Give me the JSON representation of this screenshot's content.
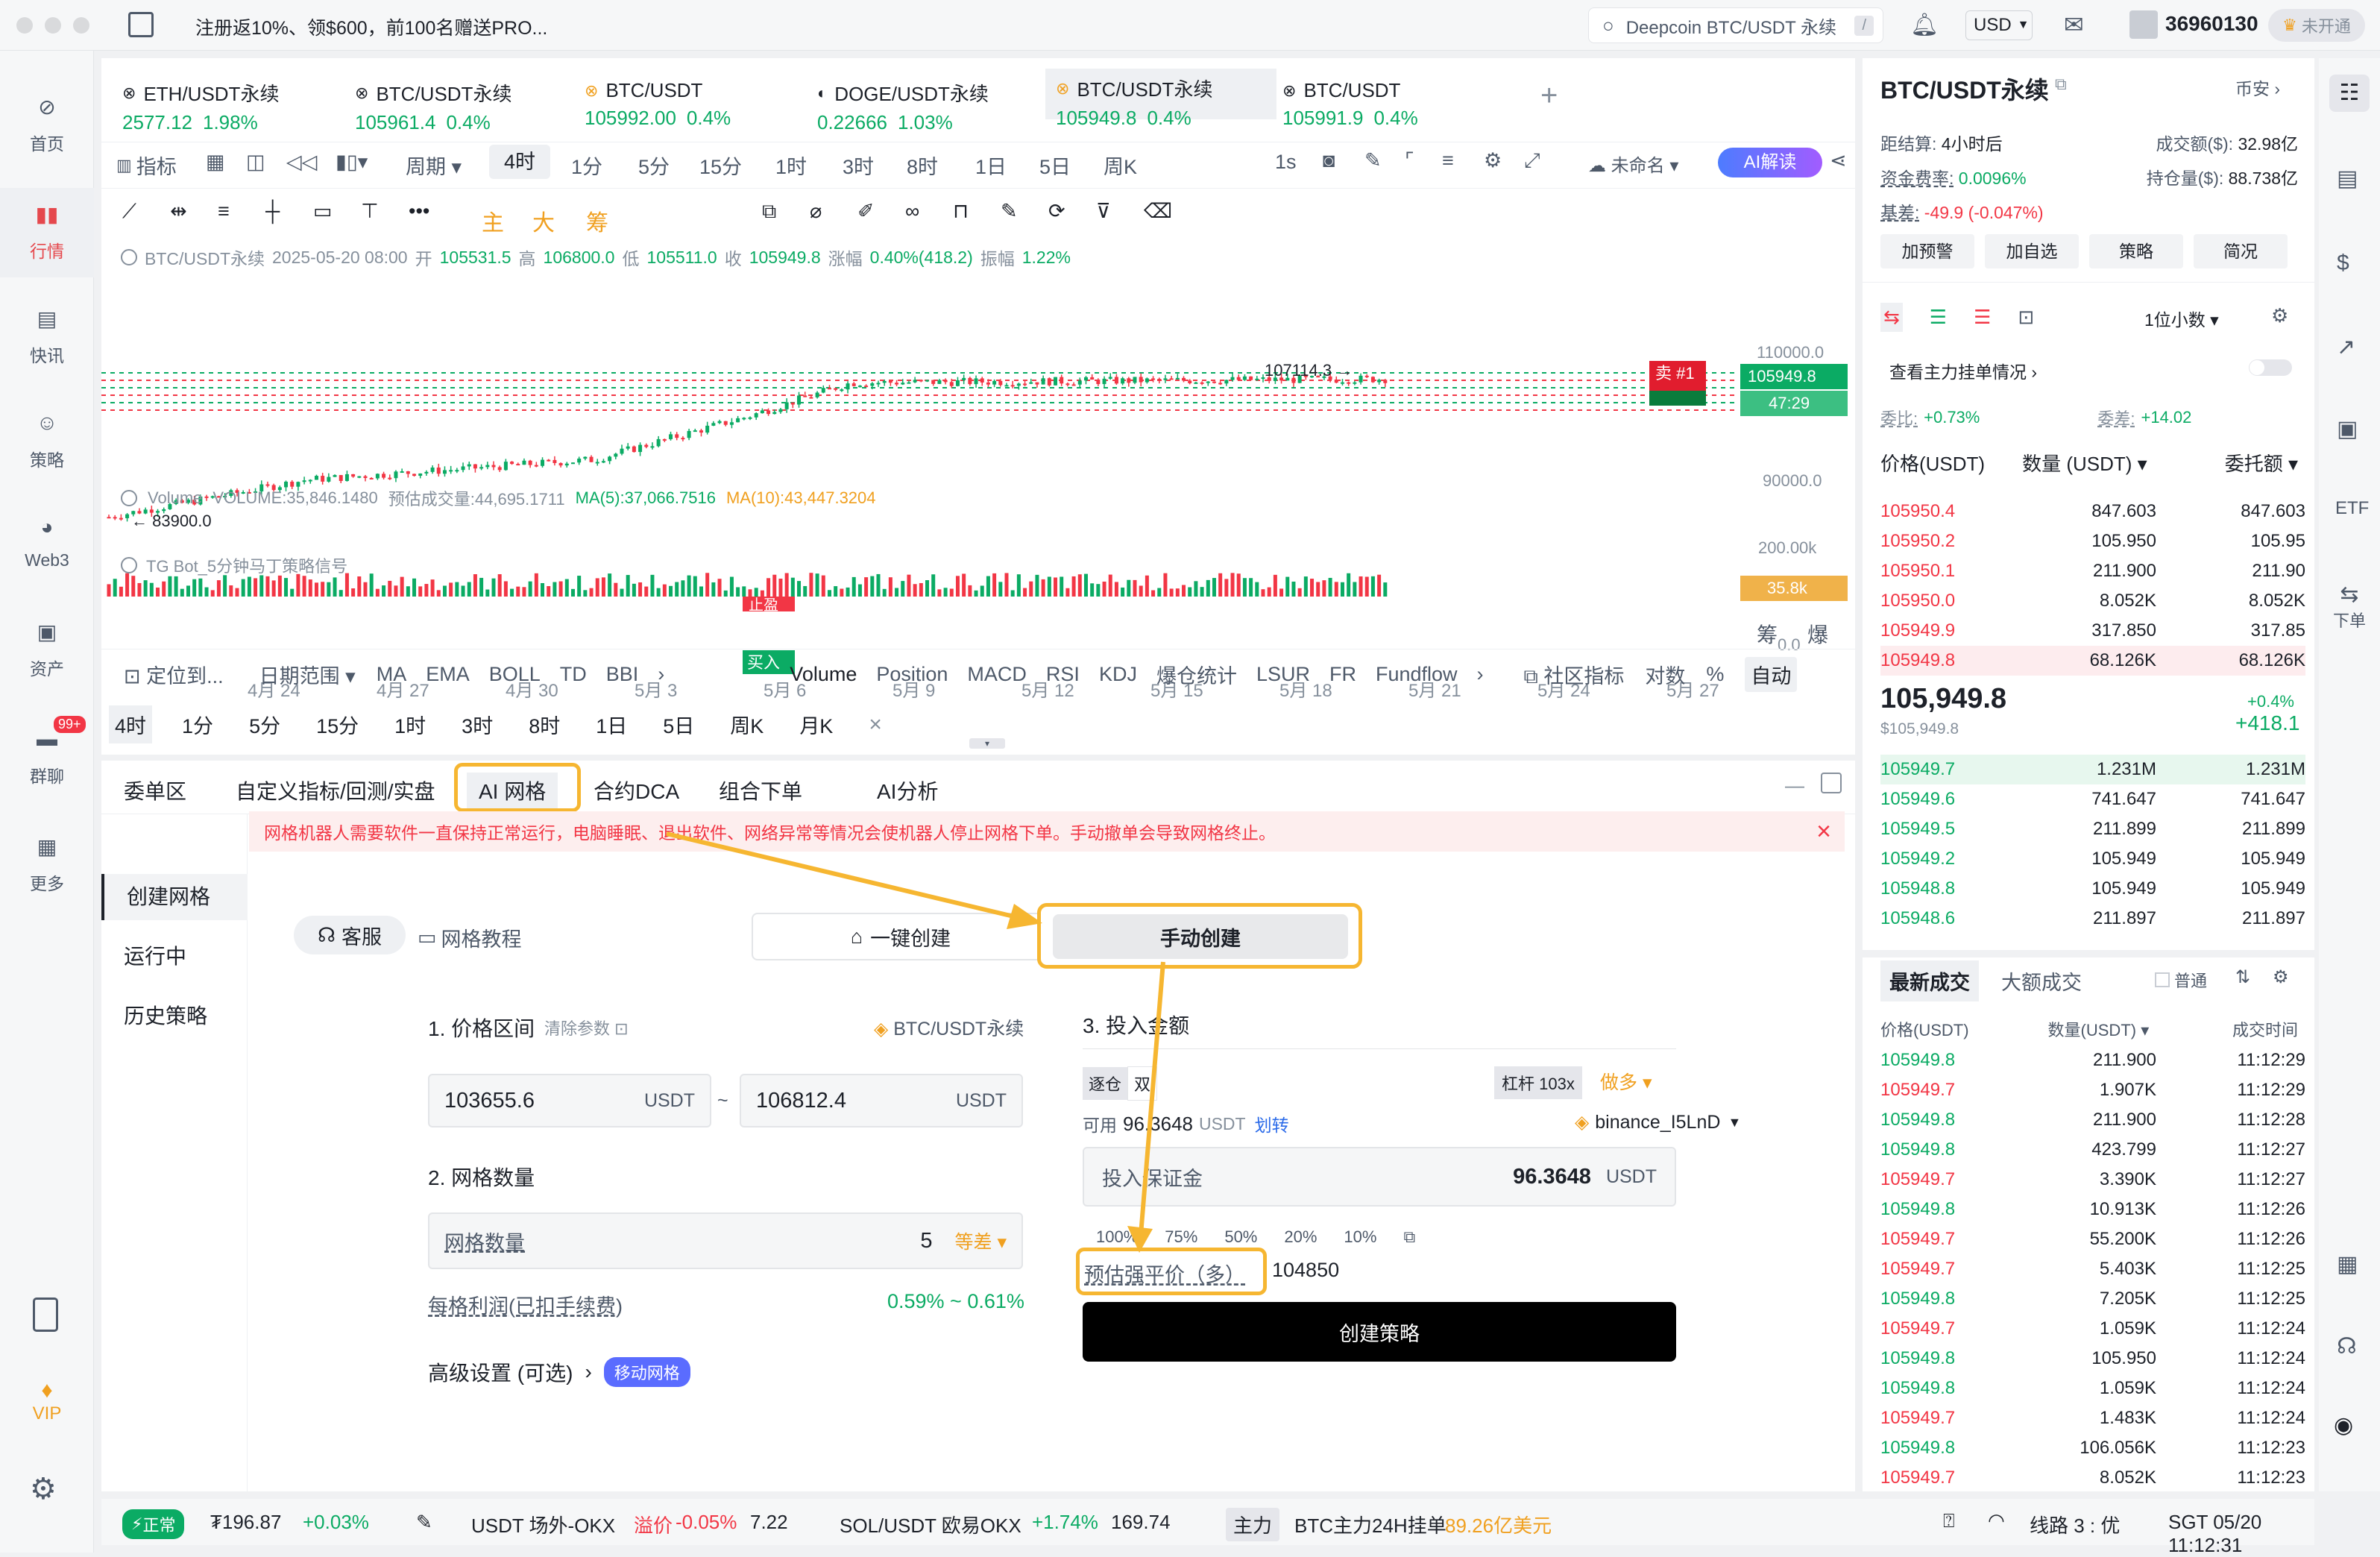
{
  "topbar": {
    "promo": "注册返10%、领$600，前100名赠送PRO...",
    "search": "Deepcoin BTC/USDT 永续",
    "search_shortcut": "/",
    "currency": "USD",
    "user_id": "36960130",
    "status": "未开通"
  },
  "leftnav": [
    {
      "label": "首页",
      "icon": "home-icon"
    },
    {
      "label": "行情",
      "icon": "chart-icon"
    },
    {
      "label": "快讯",
      "icon": "news-icon"
    },
    {
      "label": "策略",
      "icon": "robot-icon"
    },
    {
      "label": "Web3",
      "icon": "web3-icon"
    },
    {
      "label": "资产",
      "icon": "wallet-icon"
    },
    {
      "label": "群聊",
      "icon": "chat-icon",
      "badge": "99+"
    },
    {
      "label": "更多",
      "icon": "grid-icon"
    }
  ],
  "leftnav_bottom": {
    "vip": "VIP"
  },
  "tabs": [
    {
      "name": "ETH/USDT永续",
      "price": "2577.12",
      "change": "1.98%"
    },
    {
      "name": "BTC/USDT永续",
      "price": "105961.4",
      "change": "0.4%"
    },
    {
      "name": "BTC/USDT",
      "price": "105992.00",
      "change": "0.4%"
    },
    {
      "name": "DOGE/USDT永续",
      "price": "0.22666",
      "change": "1.03%"
    },
    {
      "name": "BTC/USDT永续",
      "price": "105949.8",
      "change": "0.4%"
    },
    {
      "name": "BTC/USDT",
      "price": "105991.9",
      "change": "0.4%"
    }
  ],
  "toolbar1": {
    "indicator": "指标",
    "period": "周期",
    "active": "4时",
    "periods": [
      "1分",
      "5分",
      "15分",
      "1时",
      "3时",
      "8时",
      "1日",
      "5日",
      "周K"
    ],
    "speed": "1s",
    "unnamed": "未命名",
    "ai": "AI解读"
  },
  "toolbar2": {
    "zhu": "主",
    "da": "大",
    "chou": "筹"
  },
  "chart_header": {
    "symbol": "BTC/USDT永续",
    "date": "2025-05-20 08:00",
    "open_l": "开",
    "open": "105531.5",
    "high_l": "高",
    "high": "106800.0",
    "low_l": "低",
    "low": "105511.0",
    "close_l": "收",
    "close": "105949.8",
    "chg_l": "涨幅",
    "chg": "0.40%(418.2)",
    "amp_l": "振幅",
    "amp": "1.22%"
  },
  "chart_data": {
    "type": "candlestick",
    "price_axis": [
      "110000.0",
      "90000.0"
    ],
    "high_marker": "107114.3 →",
    "low_marker": "← 83900.0",
    "current_price": "105949.8",
    "countdown": "47:29",
    "sell_tag": "卖 #1",
    "x_ticks": [
      "4月 24",
      "4月 27",
      "4月 30",
      "5月 3",
      "5月 6",
      "5月 9",
      "5月 12",
      "5月 15",
      "5月 18",
      "5月 21",
      "5月 24",
      "5月 27"
    ],
    "volume_axis": [
      "200.00k",
      "0.0"
    ],
    "volume_current": "35.8k",
    "buy_tag": "买入",
    "stop_tag": "止盈"
  },
  "volume_header": {
    "label": "Volume",
    "vol": "VOLUME:35,846.1480",
    "est": "预估成交量:44,695.1711",
    "ma5": "MA(5):37,066.7516",
    "ma10": "MA(10):43,447.3204"
  },
  "tgbot": "TG Bot_5分钟马丁策略信号",
  "axis_right_labels": {
    "chou": "筹",
    "bao": "爆"
  },
  "ind_bar": {
    "locate": "定位到...",
    "range": "日期范围",
    "main": [
      "MA",
      "EMA",
      "BOLL",
      "TD",
      "BBI"
    ],
    "sub": [
      "Volume",
      "Position",
      "MACD",
      "RSI",
      "KDJ",
      "爆仓统计",
      "LSUR",
      "FR",
      "Fundflow"
    ],
    "community": "社区指标",
    "log": "对数",
    "pct": "%",
    "auto": "自动"
  },
  "period_bar": [
    "4时",
    "1分",
    "5分",
    "15分",
    "1时",
    "3时",
    "8时",
    "1日",
    "5日",
    "周K",
    "月K"
  ],
  "bottom_tabs": [
    "委单区",
    "自定义指标/回测/实盘",
    "AI 网格",
    "合约DCA",
    "组合下单",
    "AI分析"
  ],
  "warning": "网格机器人需要软件一直保持正常运行，电脑睡眠、退出软件、网络异常等情况会使机器人停止网格下单。手动撤单会导致网格终止。",
  "side_menu": [
    "创建网格",
    "运行中",
    "历史策略"
  ],
  "grid": {
    "service": "客服",
    "tutorial": "网格教程",
    "one_click": "一键创建",
    "manual": "手动创建",
    "sec1": "1. 价格区间",
    "clear": "清除参数",
    "symbol": "BTC/USDT永续",
    "low": "103655.6",
    "high": "106812.4",
    "unit": "USDT",
    "tilde": "~",
    "sec2": "2. 网格数量",
    "count_label": "网格数量",
    "count": "5",
    "mode": "等差",
    "profit_label": "每格利润(已扣手续费)",
    "profit": "0.59% ~ 0.61%",
    "advanced": "高级设置 (可选)",
    "move": "移动网格",
    "sec3": "3. 投入金额",
    "margin_a": "逐仓",
    "margin_b": "双",
    "leverage": "杠杆 103x",
    "side": "做多",
    "avail_l": "可用",
    "avail": "96.3648",
    "avail_u": "USDT",
    "transfer": "划转",
    "account": "binance_I5LnD",
    "margin_label": "投入保证金",
    "margin_val": "96.3648",
    "margin_unit": "USDT",
    "pcts": [
      "100%",
      "75%",
      "50%",
      "20%",
      "10%"
    ],
    "liq_label": "预估强平价（多）",
    "liq": "104850",
    "create": "创建策略"
  },
  "right": {
    "title": "BTC/USDT永续",
    "exchange": "币安",
    "settle_l": "距结算:",
    "settle": "4小时后",
    "turn_l": "成交额($):",
    "turn": "32.98亿",
    "fund_l": "资金费率:",
    "fund": "0.0096%",
    "oi_l": "持仓量($):",
    "oi": "88.738亿",
    "basis_l": "基差:",
    "basis": "-49.9 (-0.047%)",
    "btns": [
      "加预警",
      "加自选",
      "策略",
      "简况"
    ],
    "decimals": "1位小数",
    "main_orders": "查看主力挂单情况",
    "ratio_l": "委比:",
    "ratio": "+0.73%",
    "diff_l": "委差:",
    "diff": "+14.02",
    "cols": [
      "价格(USDT)",
      "数量 (USDT)",
      "委托额"
    ],
    "asks": [
      [
        "105950.4",
        "847.603",
        "847.603"
      ],
      [
        "105950.2",
        "105.950",
        "105.95"
      ],
      [
        "105950.1",
        "211.900",
        "211.90"
      ],
      [
        "105950.0",
        "8.052K",
        "8.052K"
      ],
      [
        "105949.9",
        "317.850",
        "317.85"
      ],
      [
        "105949.8",
        "68.126K",
        "68.126K"
      ]
    ],
    "last": "105,949.8",
    "last_usd": "$105,949.8",
    "last_pct": "+0.4%",
    "last_chg": "+418.1",
    "bids": [
      [
        "105949.7",
        "1.231M",
        "1.231M"
      ],
      [
        "105949.6",
        "741.647",
        "741.647"
      ],
      [
        "105949.5",
        "211.899",
        "211.899"
      ],
      [
        "105949.2",
        "105.949",
        "105.949"
      ],
      [
        "105948.8",
        "105.949",
        "105.949"
      ],
      [
        "105948.6",
        "211.897",
        "211.897"
      ]
    ],
    "trade_tabs": [
      "最新成交",
      "大额成交"
    ],
    "normal": "普通",
    "trade_cols": [
      "价格(USDT)",
      "数量(USDT)",
      "成交时间"
    ],
    "trades": [
      [
        "105949.8",
        "211.900",
        "11:12:29",
        "g"
      ],
      [
        "105949.7",
        "1.907K",
        "11:12:29",
        "r"
      ],
      [
        "105949.8",
        "211.900",
        "11:12:28",
        "g"
      ],
      [
        "105949.8",
        "423.799",
        "11:12:27",
        "g"
      ],
      [
        "105949.7",
        "3.390K",
        "11:12:27",
        "r"
      ],
      [
        "105949.8",
        "10.913K",
        "11:12:26",
        "g"
      ],
      [
        "105949.7",
        "55.200K",
        "11:12:26",
        "r"
      ],
      [
        "105949.7",
        "5.403K",
        "11:12:25",
        "r"
      ],
      [
        "105949.8",
        "7.205K",
        "11:12:25",
        "g"
      ],
      [
        "105949.7",
        "1.059K",
        "11:12:24",
        "r"
      ],
      [
        "105949.8",
        "105.950",
        "11:12:24",
        "g"
      ],
      [
        "105949.8",
        "1.059K",
        "11:12:24",
        "g"
      ],
      [
        "105949.7",
        "1.483K",
        "11:12:24",
        "r"
      ],
      [
        "105949.8",
        "106.056K",
        "11:12:23",
        "g"
      ],
      [
        "105949.7",
        "8.052K",
        "11:12:23",
        "r"
      ]
    ]
  },
  "rightbar": {
    "order": "下单"
  },
  "statusbar": {
    "normal": "正常",
    "price": "₮196.87",
    "pct": "+0.03%",
    "otc": "USDT 场外-OKX",
    "premium_l": "溢价",
    "premium": "-0.05%",
    "otc_price": "7.22",
    "sol": "SOL/USDT 欧易OKX",
    "sol_pct": "+1.74%",
    "sol_price": "169.74",
    "main": "主力",
    "btc_main": "BTC主力24H挂单",
    "btc_amt": "89.26亿美元",
    "line": "线路 3 : 优",
    "time": "SGT 05/20 11:12:31"
  }
}
